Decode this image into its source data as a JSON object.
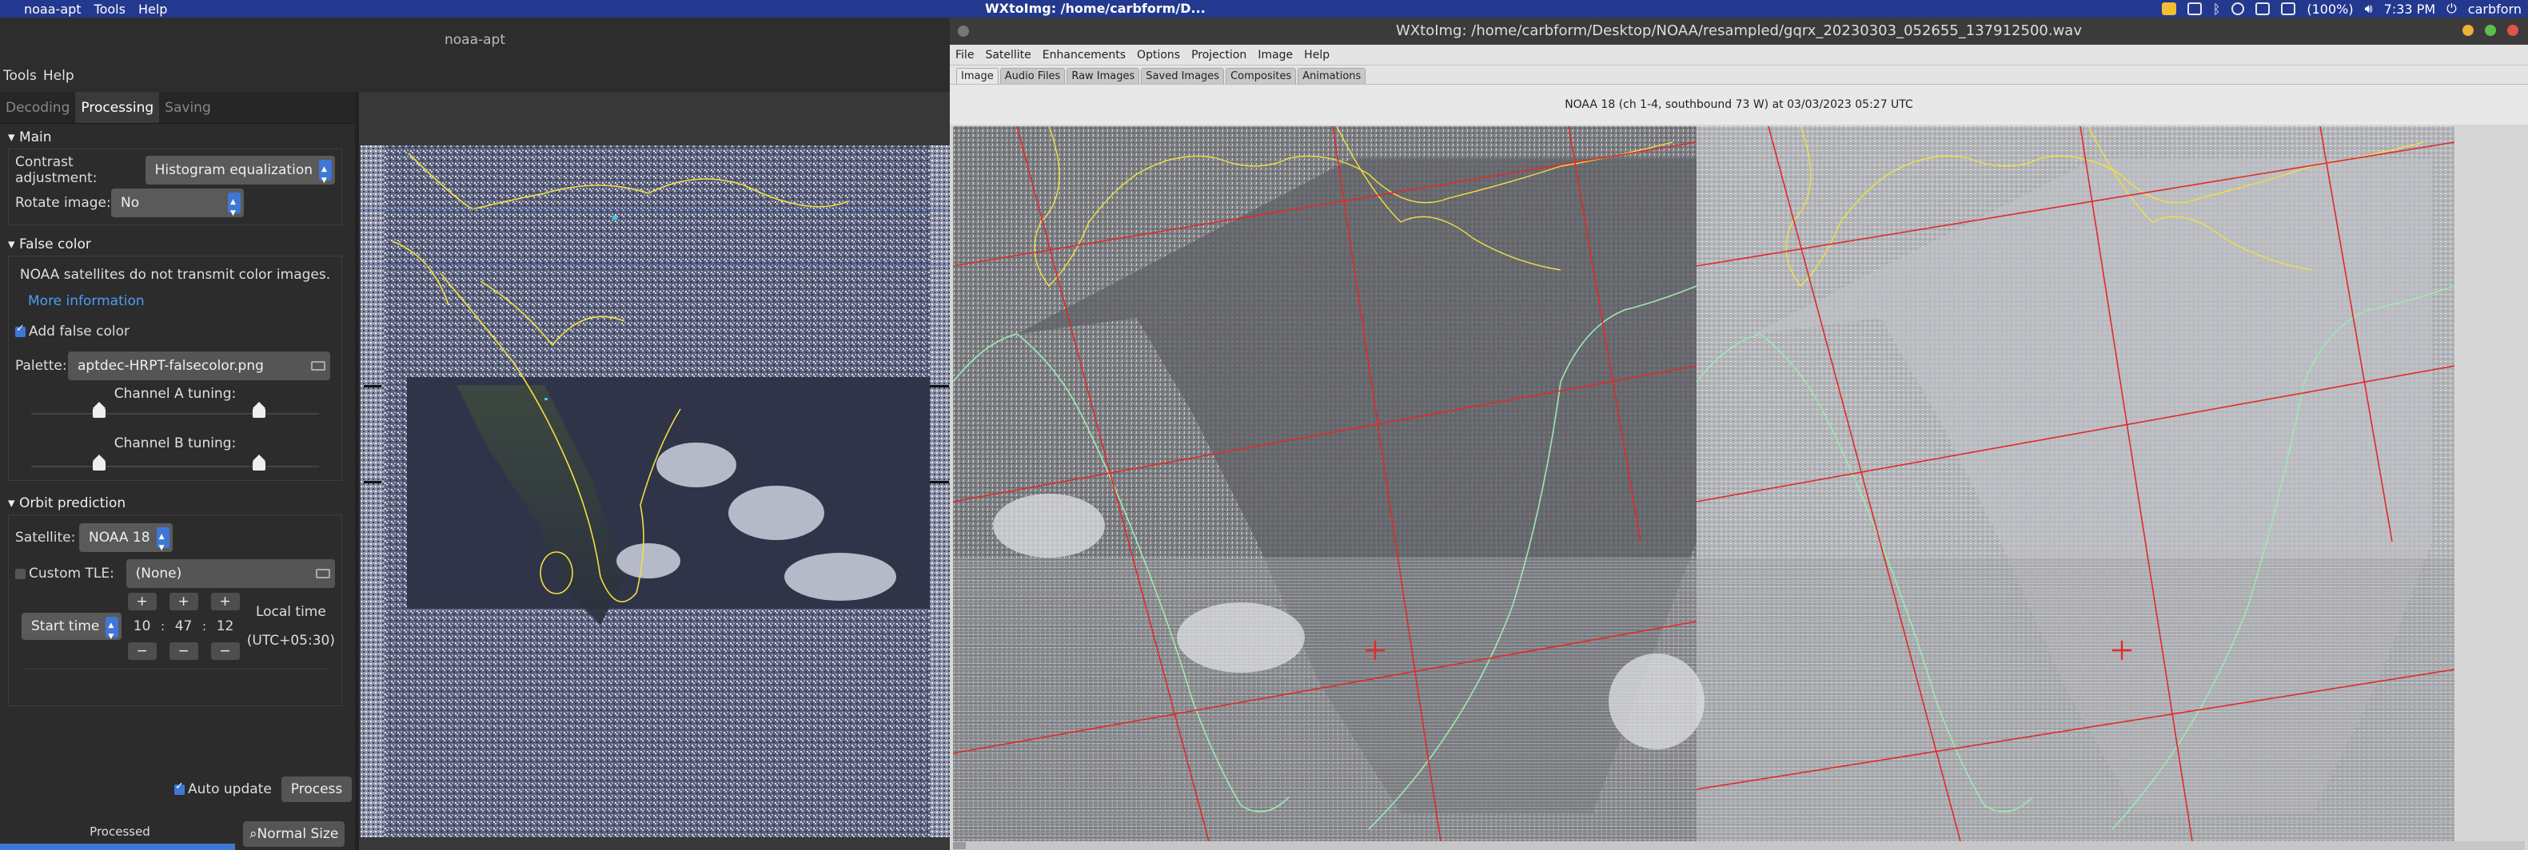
{
  "sysbar": {
    "app_name": "noaa-apt",
    "menu_tools": "Tools",
    "menu_help": "Help",
    "wx_title_short": "WXtoImg: /home/carbform/D...",
    "battery": "(100%)",
    "clock": "7:33 PM",
    "user": "carbforn"
  },
  "noaa": {
    "window_title": "noaa-apt",
    "menu": [
      "Tools",
      "Help"
    ],
    "tabs": [
      {
        "label": "Decoding",
        "active": false
      },
      {
        "label": "Processing",
        "active": true
      },
      {
        "label": "Saving",
        "active": false
      }
    ],
    "main": {
      "header": "Main",
      "contrast_label": "Contrast adjustment:",
      "contrast_value": "Histogram equalization",
      "rotate_label": "Rotate image:",
      "rotate_value": "No"
    },
    "false_color": {
      "header": "False color",
      "note": "NOAA satellites do not transmit color images.",
      "more_info": "More information",
      "add_label": "Add false color",
      "palette_label": "Palette:",
      "palette_value": "aptdec-HRPT-falsecolor.png",
      "channel_a": "Channel A tuning:",
      "channel_b": "Channel B tuning:"
    },
    "orbit": {
      "header": "Orbit prediction",
      "satellite_label": "Satellite:",
      "satellite_value": "NOAA 18",
      "custom_tle_label": "Custom TLE:",
      "custom_tle_value": "(None)",
      "start_time_label": "Start time",
      "hour": "10",
      "minute": "47",
      "second": "12",
      "sep": ":",
      "local_time": "Local time",
      "utc_offset": "(UTC+05:30)",
      "plus": "+",
      "minus": "−"
    },
    "auto_update": "Auto update",
    "process_button": "Process",
    "status": "Processed",
    "normal_size": "Normal Size"
  },
  "wx": {
    "window_title": "WXtoImg: /home/carbform/Desktop/NOAA/resampled/gqrx_20230303_052655_137912500.wav",
    "menu": [
      "File",
      "Satellite",
      "Enhancements",
      "Options",
      "Projection",
      "Image",
      "Help"
    ],
    "tabs": [
      {
        "label": "Image",
        "active": true
      },
      {
        "label": "Audio Files",
        "active": false
      },
      {
        "label": "Raw Images",
        "active": false
      },
      {
        "label": "Saved Images",
        "active": false
      },
      {
        "label": "Composites",
        "active": false
      },
      {
        "label": "Animations",
        "active": false
      }
    ],
    "caption": "NOAA 18 (ch 1-4, southbound 73 W) at 03/03/2023  05:27 UTC"
  },
  "colors": {
    "accent": "#3f77d7",
    "sysbar": "#23398f",
    "coastline": "#f0e040",
    "gridline": "#e02a2a",
    "coast_green": "#8fe0a0"
  }
}
